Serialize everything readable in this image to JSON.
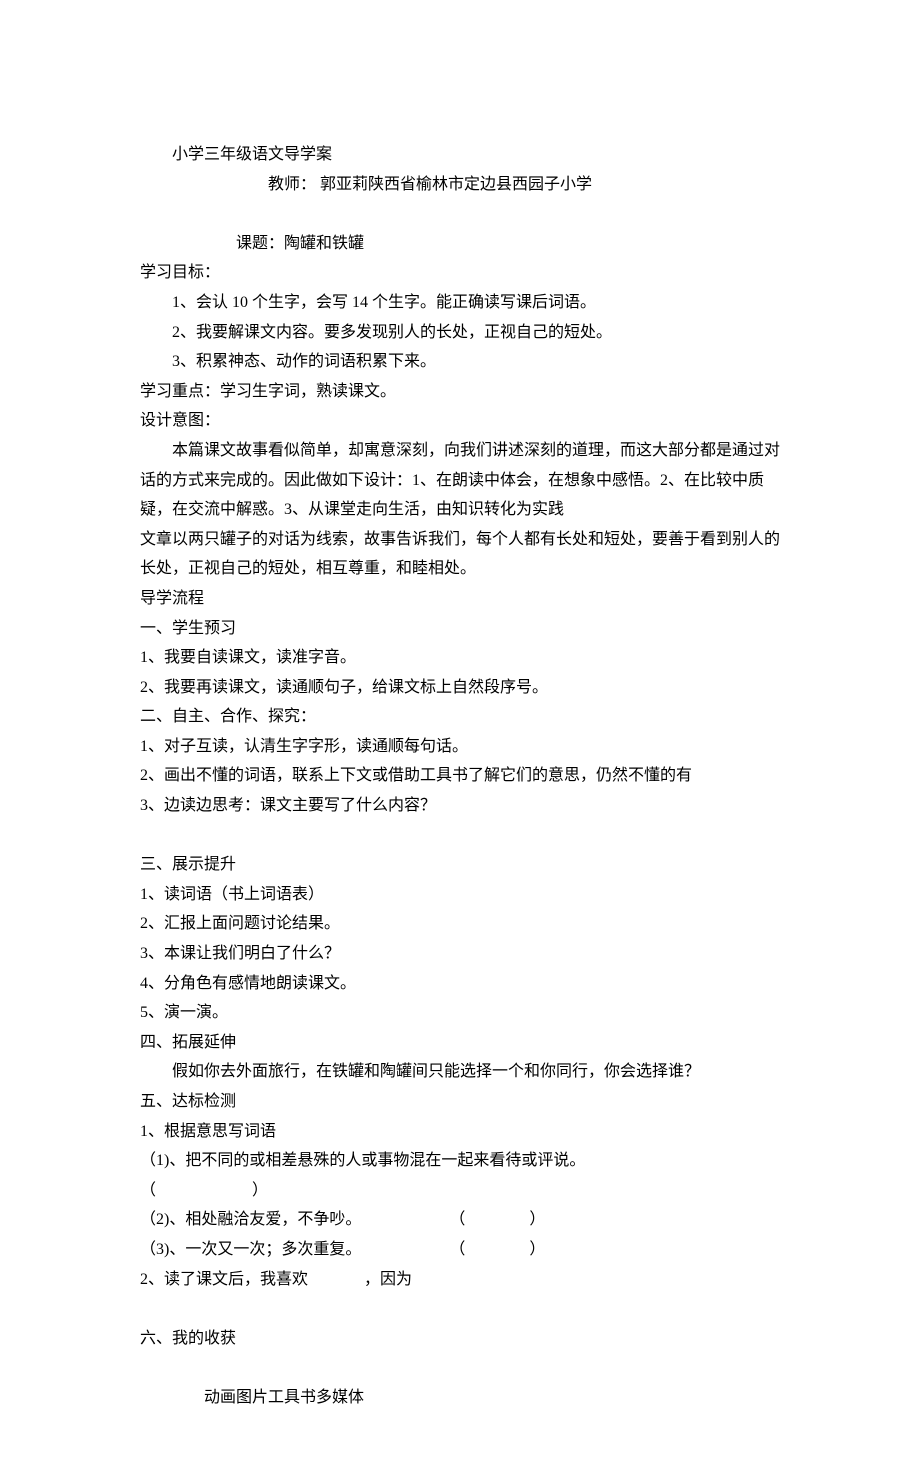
{
  "header": {
    "title": "小学三年级语文导学案",
    "teacher_line": "教师：  郭亚莉陕西省榆林市定边县西园子小学"
  },
  "topic": {
    "label": "课题：陶罐和铁罐"
  },
  "goals": {
    "heading": "学习目标：",
    "items": [
      "1、会认 10 个生字，会写 14 个生字。能正确读写课后词语。",
      "  2、我要解课文内容。要多发现别人的长处，正视自己的短处。",
      "3、积累神态、动作的词语积累下来。"
    ]
  },
  "focus": "学习重点：学习生字词，熟读课文。",
  "intent": {
    "heading": "设计意图：",
    "para1": "本篇课文故事看似简单，却寓意深刻，向我们讲述深刻的道理，而这大部分都是通过对话的方式来完成的。因此做如下设计：1、在朗读中体会，在想象中感悟。2、在比较中质疑，在交流中解惑。3、从课堂走向生活，由知识转化为实践",
    "para2": "文章以两只罐子的对话为线索，故事告诉我们，每个人都有长处和短处，要善于看到别人的长处，正视自己的短处，相互尊重，和睦相处。"
  },
  "process": {
    "heading": "导学流程",
    "section1": {
      "title": "一、学生预习",
      "items": [
        "1、我要自读课文，读准字音。",
        "2、我要再读课文，读通顺句子，给课文标上自然段序号。"
      ]
    },
    "section2": {
      "title": "二、自主、合作、探究：",
      "items": [
        "1、对子互读，认清生字字形，读通顺每句话。",
        "2、画出不懂的词语，联系上下文或借助工具书了解它们的意思，仍然不懂的有",
        "3、边读边思考：课文主要写了什么内容？"
      ]
    },
    "section3": {
      "title": "三、展示提升",
      "items": [
        "1、读词语（书上词语表）",
        "2、汇报上面问题讨论结果。",
        "3、本课让我们明白了什么？",
        "4、分角色有感情地朗读课文。",
        "5、演一演。"
      ]
    },
    "section4": {
      "title": "四、拓展延伸",
      "text": "假如你去外面旅行，在铁罐和陶罐间只能选择一个和你同行，你会选择谁？"
    },
    "section5": {
      "title": "五、达标检测",
      "item1": "1、根据意思写词语",
      "q1_text": "（1)、把不同的或相差悬殊的人或事物混在一起来看待或评说。",
      "q1_paren": "（）",
      "q2_text": "（2)、相处融洽友爱，不争吵。",
      "q2_paren": "（）",
      "q3_text": "（3)、一次又一次；多次重复。",
      "q3_paren": "（）",
      "item2_a": "2、读了课文后，我喜欢",
      "item2_b": "，因为"
    },
    "section6": {
      "title": "六、我的收获"
    }
  },
  "footer": {
    "text": "动画图片工具书多媒体"
  }
}
